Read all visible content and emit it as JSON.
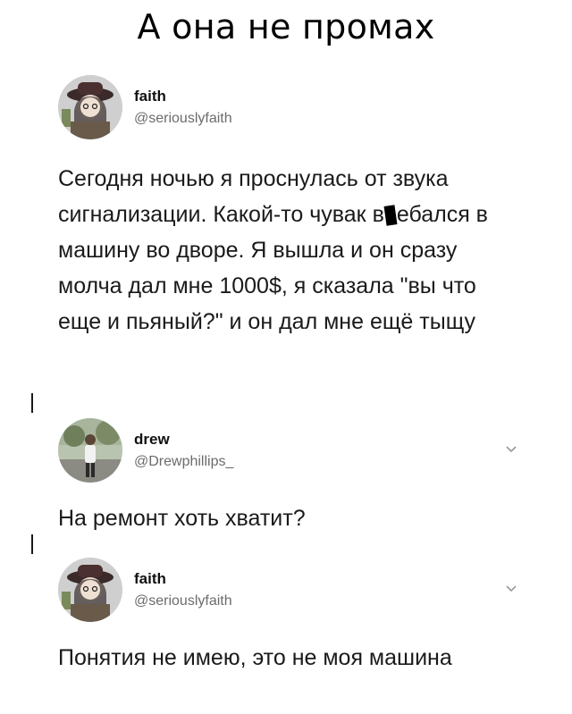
{
  "page": {
    "title": "А она не промах"
  },
  "tweets": [
    {
      "display_name": "faith",
      "handle": "@seriouslyfaith",
      "text_before": "Сегодня ночью я проснулась от звука сигнализации. Какой-то чувак в",
      "text_after": "ебался в машину во дворе. Я вышла и он сразу молча дал мне 1000$, я сказала \"вы что еще и пьяный?\" и он дал мне ещё тыщу",
      "avatar_icon": "user-photo-avatar",
      "has_menu": false
    },
    {
      "display_name": "drew",
      "handle": "@Drewphillips_",
      "text": "На ремонт хоть хватит?",
      "avatar_icon": "user-photo-avatar",
      "has_menu": true,
      "menu_icon": "chevron-down-icon"
    },
    {
      "display_name": "faith",
      "handle": "@seriouslyfaith",
      "text": "Понятия не имею, это не моя машина",
      "avatar_icon": "user-photo-avatar",
      "has_menu": true,
      "menu_icon": "chevron-down-icon"
    }
  ]
}
